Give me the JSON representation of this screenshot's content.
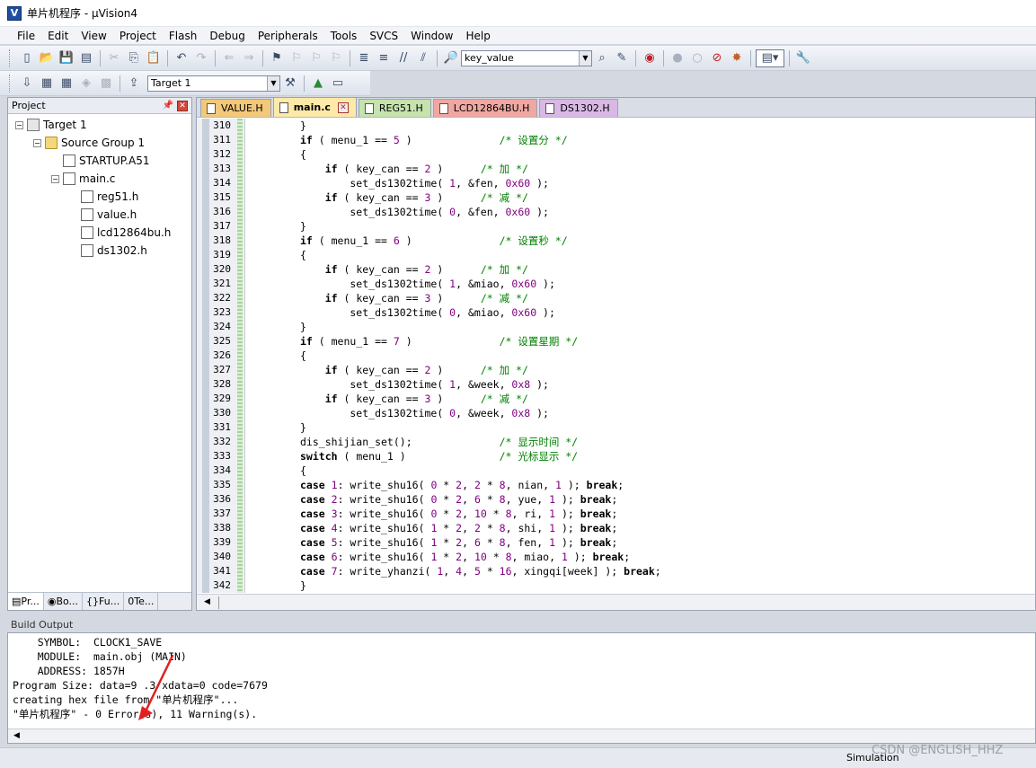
{
  "window": {
    "title": "单片机程序 - µVision4",
    "icon": "uvision-icon"
  },
  "menu": [
    "File",
    "Edit",
    "View",
    "Project",
    "Flash",
    "Debug",
    "Peripherals",
    "Tools",
    "SVCS",
    "Window",
    "Help"
  ],
  "toolbar": {
    "find_value": "key_value",
    "target_value": "Target 1"
  },
  "project_panel": {
    "title": "Project",
    "tree": [
      {
        "label": "Target 1",
        "level": 0,
        "type": "target",
        "expander": "−"
      },
      {
        "label": "Source Group 1",
        "level": 1,
        "type": "folder",
        "expander": "−"
      },
      {
        "label": "STARTUP.A51",
        "level": 2,
        "type": "file",
        "expander": ""
      },
      {
        "label": "main.c",
        "level": 2,
        "type": "file",
        "expander": "−"
      },
      {
        "label": "reg51.h",
        "level": 3,
        "type": "file",
        "expander": ""
      },
      {
        "label": "value.h",
        "level": 3,
        "type": "file",
        "expander": ""
      },
      {
        "label": "lcd12864bu.h",
        "level": 3,
        "type": "file",
        "expander": ""
      },
      {
        "label": "ds1302.h",
        "level": 3,
        "type": "file",
        "expander": ""
      }
    ],
    "tabs": [
      "Pr...",
      "Bo...",
      "Fu...",
      "Te..."
    ]
  },
  "editor": {
    "tabs": [
      {
        "label": "VALUE.H",
        "color": "#f3c879",
        "active": false,
        "closable": false
      },
      {
        "label": "main.c",
        "color": "#f3c879",
        "active": true,
        "closable": true
      },
      {
        "label": "REG51.H",
        "color": "#c6e3ad",
        "active": false,
        "closable": false
      },
      {
        "label": "LCD12864BU.H",
        "color": "#f0a7a2",
        "active": false,
        "closable": false
      },
      {
        "label": "DS1302.H",
        "color": "#d9b8e6",
        "active": false,
        "closable": false
      }
    ],
    "lines": [
      {
        "n": "310",
        "t": "        }"
      },
      {
        "n": "311",
        "t": "        if ( menu_1 == 5 )              /* 设置分 */"
      },
      {
        "n": "312",
        "t": "        {"
      },
      {
        "n": "313",
        "t": "            if ( key_can == 2 )      /* 加 */"
      },
      {
        "n": "314",
        "t": "                set_ds1302time( 1, &fen, 0x60 );"
      },
      {
        "n": "315",
        "t": "            if ( key_can == 3 )      /* 减 */"
      },
      {
        "n": "316",
        "t": "                set_ds1302time( 0, &fen, 0x60 );"
      },
      {
        "n": "317",
        "t": "        }"
      },
      {
        "n": "318",
        "t": "        if ( menu_1 == 6 )              /* 设置秒 */"
      },
      {
        "n": "319",
        "t": "        {"
      },
      {
        "n": "320",
        "t": "            if ( key_can == 2 )      /* 加 */"
      },
      {
        "n": "321",
        "t": "                set_ds1302time( 1, &miao, 0x60 );"
      },
      {
        "n": "322",
        "t": "            if ( key_can == 3 )      /* 减 */"
      },
      {
        "n": "323",
        "t": "                set_ds1302time( 0, &miao, 0x60 );"
      },
      {
        "n": "324",
        "t": "        }"
      },
      {
        "n": "325",
        "t": "        if ( menu_1 == 7 )              /* 设置星期 */"
      },
      {
        "n": "326",
        "t": "        {"
      },
      {
        "n": "327",
        "t": "            if ( key_can == 2 )      /* 加 */"
      },
      {
        "n": "328",
        "t": "                set_ds1302time( 1, &week, 0x8 );"
      },
      {
        "n": "329",
        "t": "            if ( key_can == 3 )      /* 减 */"
      },
      {
        "n": "330",
        "t": "                set_ds1302time( 0, &week, 0x8 );"
      },
      {
        "n": "331",
        "t": "        }"
      },
      {
        "n": "332",
        "t": "        dis_shijian_set();              /* 显示时间 */"
      },
      {
        "n": "333",
        "t": "        switch ( menu_1 )               /* 光标显示 */"
      },
      {
        "n": "334",
        "t": "        {"
      },
      {
        "n": "335",
        "t": "        case 1: write_shu16( 0 * 2, 2 * 8, nian, 1 ); break;"
      },
      {
        "n": "336",
        "t": "        case 2: write_shu16( 0 * 2, 6 * 8, yue, 1 ); break;"
      },
      {
        "n": "337",
        "t": "        case 3: write_shu16( 0 * 2, 10 * 8, ri, 1 ); break;"
      },
      {
        "n": "338",
        "t": "        case 4: write_shu16( 1 * 2, 2 * 8, shi, 1 ); break;"
      },
      {
        "n": "339",
        "t": "        case 5: write_shu16( 1 * 2, 6 * 8, fen, 1 ); break;"
      },
      {
        "n": "340",
        "t": "        case 6: write_shu16( 1 * 2, 10 * 8, miao, 1 ); break;"
      },
      {
        "n": "341",
        "t": "        case 7: write_yhanzi( 1, 4, 5 * 16, xingqi[week] ); break;"
      },
      {
        "n": "342",
        "t": "        }"
      }
    ]
  },
  "build_output": {
    "title": "Build Output",
    "lines": [
      "    SYMBOL:  CLOCK1_SAVE",
      "    MODULE:  main.obj (MAIN)",
      "    ADDRESS: 1857H",
      "Program Size: data=9 .3 xdata=0 code=7679",
      "creating hex file from \"单片机程序\"...",
      "\"单片机程序\" - 0 Error(s), 11 Warning(s)."
    ]
  },
  "status": {
    "mode": "Simulation",
    "watermark": "CSDN @ENGLISH_HHZ"
  },
  "colors": {
    "keyword": "#000000",
    "number": "#800080",
    "comment": "#008000",
    "annotation_arrow": "#e02020"
  }
}
